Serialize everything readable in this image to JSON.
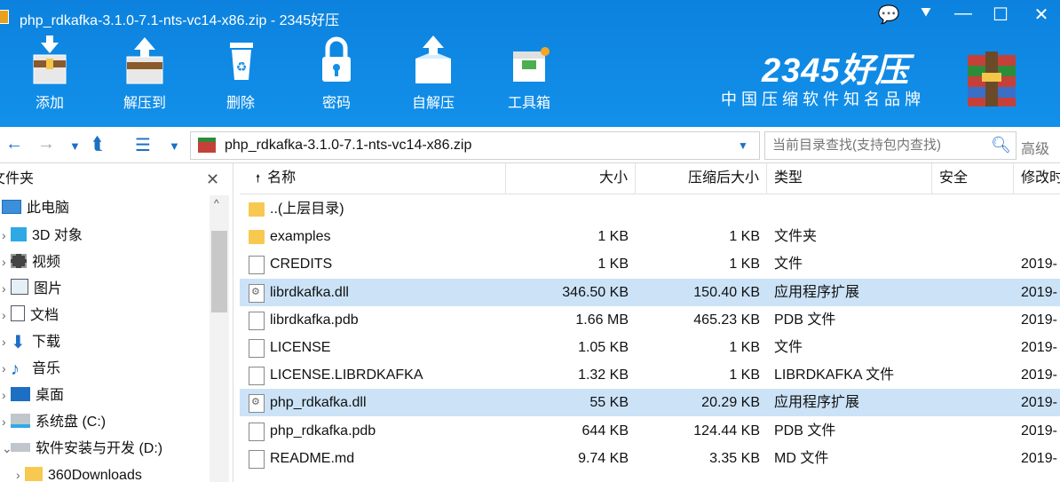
{
  "window": {
    "title": "php_rdkafka-3.1.0-7.1-nts-vc14-x86.zip - 2345好压",
    "controls": [
      "💬",
      "⯆",
      "—",
      "☐",
      "✕"
    ]
  },
  "toolbar": {
    "items": [
      {
        "label": "添加",
        "icon": "add-archive-icon"
      },
      {
        "label": "解压到",
        "icon": "extract-to-icon"
      },
      {
        "label": "删除",
        "icon": "delete-icon"
      },
      {
        "label": "密码",
        "icon": "lock-icon"
      },
      {
        "label": "自解压",
        "icon": "self-extract-icon"
      },
      {
        "label": "工具箱",
        "icon": "toolbox-icon"
      }
    ]
  },
  "brand": {
    "name": "2345好压",
    "slogan": "中国压缩软件知名品牌"
  },
  "address": {
    "path": "php_rdkafka-3.1.0-7.1-nts-vc14-x86.zip",
    "search_placeholder": "当前目录查找(支持包内查找)",
    "advanced": "高级"
  },
  "sidebar": {
    "title": "文件夹",
    "items": [
      {
        "label": "此电脑",
        "icon": "computer-icon",
        "expander": ""
      },
      {
        "label": "3D 对象",
        "icon": "3d-objects-icon",
        "expander": "›"
      },
      {
        "label": "视频",
        "icon": "video-icon",
        "expander": "›"
      },
      {
        "label": "图片",
        "icon": "pictures-icon",
        "expander": "›"
      },
      {
        "label": "文档",
        "icon": "documents-icon",
        "expander": "›"
      },
      {
        "label": "下载",
        "icon": "download-icon",
        "expander": "›"
      },
      {
        "label": "音乐",
        "icon": "music-icon",
        "expander": "›"
      },
      {
        "label": "桌面",
        "icon": "desktop-icon",
        "expander": "›"
      },
      {
        "label": "系统盘 (C:)",
        "icon": "system-drive-icon",
        "expander": "›"
      },
      {
        "label": "软件安装与开发 (D:)",
        "icon": "drive-icon",
        "expander": "⌄"
      },
      {
        "label": "360Downloads",
        "icon": "folder-icon",
        "expander": "›"
      }
    ]
  },
  "columns": {
    "name": "名称",
    "size": "大小",
    "packed": "压缩后大小",
    "type": "类型",
    "security": "安全",
    "modified": "修改时"
  },
  "files": [
    {
      "name": "..(上层目录)",
      "size": "",
      "packed": "",
      "type": "",
      "modified": "",
      "kind": "folder"
    },
    {
      "name": "examples",
      "size": "1 KB",
      "packed": "1 KB",
      "type": "文件夹",
      "modified": "",
      "kind": "folder"
    },
    {
      "name": "CREDITS",
      "size": "1 KB",
      "packed": "1 KB",
      "type": "文件",
      "modified": "2019-",
      "kind": "doc"
    },
    {
      "name": "librdkafka.dll",
      "size": "346.50 KB",
      "packed": "150.40 KB",
      "type": "应用程序扩展",
      "modified": "2019-",
      "kind": "dll",
      "selected": true
    },
    {
      "name": "librdkafka.pdb",
      "size": "1.66 MB",
      "packed": "465.23 KB",
      "type": "PDB 文件",
      "modified": "2019-",
      "kind": "doc"
    },
    {
      "name": "LICENSE",
      "size": "1.05 KB",
      "packed": "1 KB",
      "type": "文件",
      "modified": "2019-",
      "kind": "doc"
    },
    {
      "name": "LICENSE.LIBRDKAFKA",
      "size": "1.32 KB",
      "packed": "1 KB",
      "type": "LIBRDKAFKA 文件",
      "modified": "2019-",
      "kind": "doc"
    },
    {
      "name": "php_rdkafka.dll",
      "size": "55 KB",
      "packed": "20.29 KB",
      "type": "应用程序扩展",
      "modified": "2019-",
      "kind": "dll",
      "selected": true
    },
    {
      "name": "php_rdkafka.pdb",
      "size": "644 KB",
      "packed": "124.44 KB",
      "type": "PDB 文件",
      "modified": "2019-",
      "kind": "doc"
    },
    {
      "name": "README.md",
      "size": "9.74 KB",
      "packed": "3.35 KB",
      "type": "MD 文件",
      "modified": "2019-",
      "kind": "doc"
    }
  ],
  "colors": {
    "banner": "#0f86e0",
    "selection": "#cce3f7",
    "nav_blue": "#1d6fc4"
  }
}
